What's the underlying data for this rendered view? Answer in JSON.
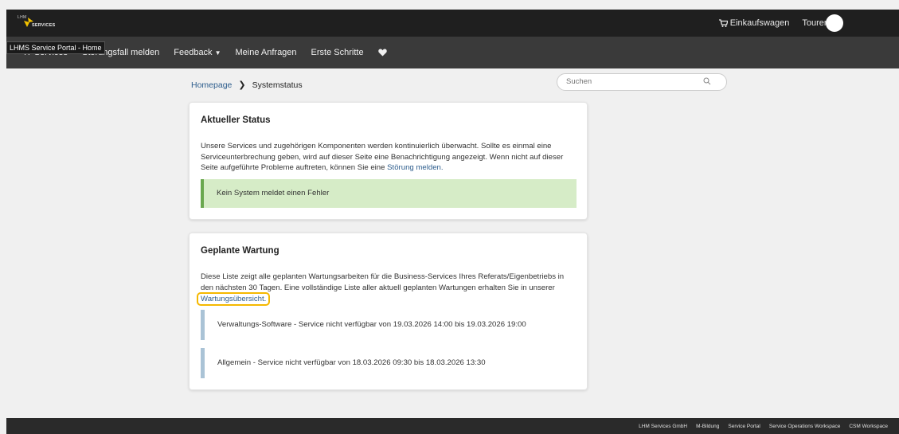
{
  "header": {
    "logo_top": "LHM",
    "logo_bottom": "SERVICES",
    "cart_label": "Einkaufswagen",
    "tours_label": "Touren"
  },
  "nav": {
    "tooltip": "LHMS Service Portal - Home",
    "items": [
      {
        "label": "IT-Services"
      },
      {
        "label": "Störungsfall melden"
      },
      {
        "label": "Feedback"
      },
      {
        "label": "Meine Anfragen"
      },
      {
        "label": "Erste Schritte"
      }
    ]
  },
  "breadcrumb": {
    "home": "Homepage",
    "current": "Systemstatus"
  },
  "search": {
    "value": "Suchen"
  },
  "status_card": {
    "title": "Aktueller Status",
    "text_before_link": "Unsere Services und zugehörigen Komponenten werden kontinuierlich überwacht. Sollte es einmal eine Serviceunterbrechung geben, wird auf dieser Seite eine Benachrichtigung angezeigt. Wenn nicht auf dieser Seite aufgeführte Probleme auftreten, können Sie eine ",
    "link": "Störung melden.",
    "status_message": "Kein System meldet einen Fehler"
  },
  "maintenance_card": {
    "title": "Geplante Wartung",
    "text": "Diese Liste zeigt alle geplanten Wartungsarbeiten für die Business-Services Ihres Referats/Eigenbetriebs in den nächsten 30 Tagen. Eine vollständige Liste aller aktuell geplanten Wartungen erhalten Sie in unserer",
    "link": "Wartungsübersicht.",
    "items": [
      {
        "text": "Verwaltungs-Software - Service nicht verfügbar von 19.03.2026 14:00 bis 19.03.2026 19:00"
      },
      {
        "text": "Allgemein - Service nicht verfügbar von 18.03.2026 09:30 bis 18.03.2026 13:30"
      }
    ]
  },
  "footer": {
    "links": [
      "LHM Services GmbH",
      "M-Bildung",
      "Service Portal",
      "Service Operations Workspace",
      "CSM Workspace"
    ]
  },
  "colors": {
    "header_bg": "#1f1f1f",
    "nav_bg": "#3a3a3a",
    "link": "#2c5c8c",
    "status_ok_bg": "#d6ecc7",
    "status_ok_border": "#6aa84f",
    "maint_border": "#aac3d6",
    "highlight": "#f5b800",
    "logo_accent": "#f2c200"
  }
}
